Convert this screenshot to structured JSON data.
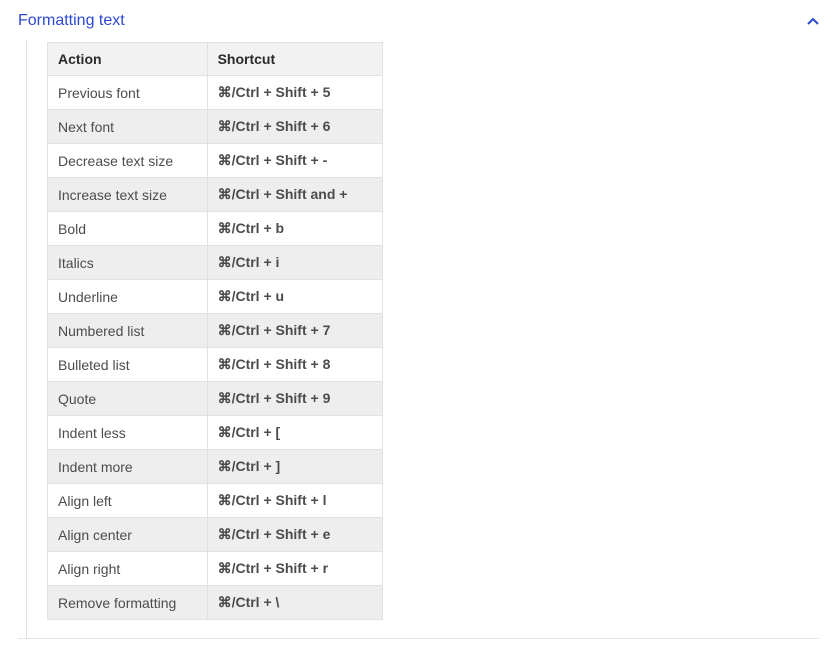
{
  "section": {
    "title": "Formatting text",
    "expanded": true
  },
  "table": {
    "headers": {
      "action": "Action",
      "shortcut": "Shortcut"
    },
    "rows": [
      {
        "action": "Previous font",
        "shortcut": "⌘/Ctrl + Shift + 5"
      },
      {
        "action": "Next font",
        "shortcut": "⌘/Ctrl + Shift + 6"
      },
      {
        "action": "Decrease text size",
        "shortcut": "⌘/Ctrl + Shift + -"
      },
      {
        "action": "Increase text size",
        "shortcut": "⌘/Ctrl + Shift and +"
      },
      {
        "action": "Bold",
        "shortcut": "⌘/Ctrl + b"
      },
      {
        "action": "Italics",
        "shortcut": "⌘/Ctrl + i"
      },
      {
        "action": "Underline",
        "shortcut": "⌘/Ctrl + u"
      },
      {
        "action": "Numbered list",
        "shortcut": "⌘/Ctrl + Shift + 7"
      },
      {
        "action": "Bulleted list",
        "shortcut": "⌘/Ctrl + Shift + 8"
      },
      {
        "action": "Quote",
        "shortcut": "⌘/Ctrl + Shift + 9"
      },
      {
        "action": "Indent less",
        "shortcut": "⌘/Ctrl + ["
      },
      {
        "action": "Indent more",
        "shortcut": "⌘/Ctrl + ]"
      },
      {
        "action": "Align left",
        "shortcut": "⌘/Ctrl + Shift + l"
      },
      {
        "action": "Align center",
        "shortcut": "⌘/Ctrl + Shift + e"
      },
      {
        "action": "Align right",
        "shortcut": "⌘/Ctrl + Shift + r"
      },
      {
        "action": "Remove formatting",
        "shortcut": "⌘/Ctrl + \\"
      }
    ]
  }
}
